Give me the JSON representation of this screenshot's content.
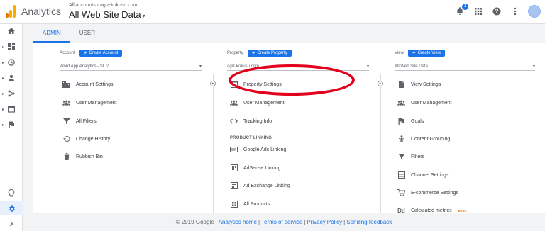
{
  "topbar": {
    "app_title": "Analytics",
    "breadcrumb": "All accounts › agiz-kokusu.com",
    "view_title": "All Web Site Data",
    "view_caret": "▾",
    "notification_count": "1"
  },
  "tabs": [
    {
      "label": "ADMIN"
    },
    {
      "label": "USER"
    }
  ],
  "account": {
    "label": "Account",
    "create_label": "Create Account",
    "select_value": "Word App Analytics - SL 2",
    "items": [
      {
        "label": "Account Settings",
        "icon": "building-icon"
      },
      {
        "label": "User Management",
        "icon": "users-icon"
      },
      {
        "label": "All Filters",
        "icon": "filter-icon"
      },
      {
        "label": "Change History",
        "icon": "history-icon"
      },
      {
        "label": "Rubbish Bin",
        "icon": "trash-icon"
      }
    ]
  },
  "property": {
    "label": "Property",
    "create_label": "Create Property",
    "select_value": "agiz-kokusu.com",
    "items": [
      {
        "label": "Property Settings",
        "icon": "settings-page-icon"
      },
      {
        "label": "User Management",
        "icon": "users-icon"
      },
      {
        "label": "Tracking Info",
        "icon": "code-icon"
      }
    ],
    "section_label": "PRODUCT LINKING",
    "linking_items": [
      {
        "label": "Google Ads Linking",
        "icon": "ads-icon"
      },
      {
        "label": "AdSense Linking",
        "icon": "adsense-icon"
      },
      {
        "label": "Ad Exchange Linking",
        "icon": "adexchange-icon"
      },
      {
        "label": "All Products",
        "icon": "products-icon"
      }
    ]
  },
  "view": {
    "label": "View",
    "create_label": "Create View",
    "select_value": "All Web Site Data",
    "items": [
      {
        "label": "View Settings",
        "icon": "document-icon"
      },
      {
        "label": "User Management",
        "icon": "users-icon"
      },
      {
        "label": "Goals",
        "icon": "flag-icon"
      },
      {
        "label": "Content Grouping",
        "icon": "grouping-icon"
      },
      {
        "label": "Filters",
        "icon": "filter-icon"
      },
      {
        "label": "Channel Settings",
        "icon": "channel-icon"
      },
      {
        "label": "E-commerce Settings",
        "icon": "cart-icon"
      },
      {
        "label": "Calculated metrics",
        "icon": "calc-icon",
        "badge": "BETA"
      }
    ]
  },
  "footer": {
    "copyright": "© 2019 Google",
    "links": [
      "Analytics home",
      "Terms of service",
      "Privacy Policy",
      "Sending feedback"
    ],
    "separator": "|"
  },
  "colors": {
    "accent": "#1a73e8",
    "highlight": "#e3001b",
    "logo_orange": "#f9ab00",
    "logo_dark": "#e37400"
  }
}
